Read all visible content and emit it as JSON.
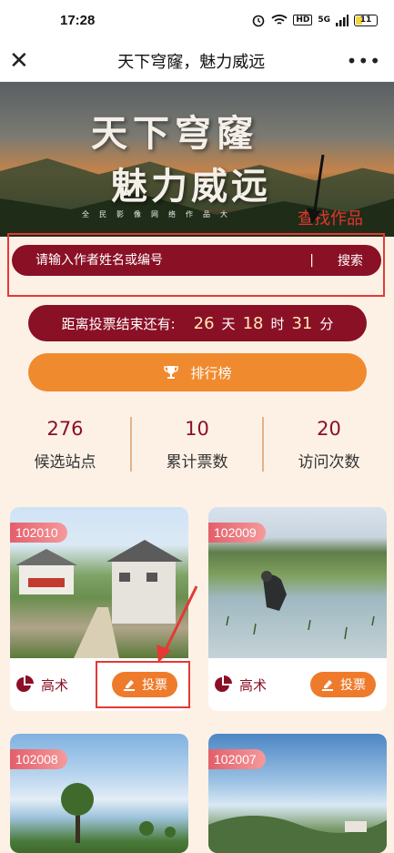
{
  "status": {
    "time": "17:28",
    "network": "5G",
    "hd": "HD",
    "battery": "11"
  },
  "nav": {
    "title": "天下穹窿，魅力威远"
  },
  "banner": {
    "title_line1": "天下穹窿",
    "title_line2": "魅力威远",
    "subtitle": "全民影像网络作品大",
    "hint": "查找作品"
  },
  "search": {
    "placeholder": "请输入作者姓名或编号",
    "divider": "|",
    "button": "搜索"
  },
  "countdown": {
    "label": "距离投票结束还有:",
    "days": "26",
    "days_unit": "天",
    "hours": "18",
    "hours_unit": "时",
    "minutes": "31",
    "minutes_unit": "分"
  },
  "ranking": {
    "label": "排行榜"
  },
  "stats": [
    {
      "value": "276",
      "label": "候选站点"
    },
    {
      "value": "10",
      "label": "累计票数"
    },
    {
      "value": "20",
      "label": "访问次数"
    }
  ],
  "cards": [
    {
      "id": "102010",
      "author": "高术",
      "vote": "投票"
    },
    {
      "id": "102009",
      "author": "高术",
      "vote": "投票"
    },
    {
      "id": "102008",
      "author": "",
      "vote": ""
    },
    {
      "id": "102007",
      "author": "",
      "vote": ""
    }
  ],
  "colors": {
    "primary": "#8a1026",
    "accent": "#f08a2e",
    "annotation": "#e53935",
    "background": "#fdf1e6"
  }
}
